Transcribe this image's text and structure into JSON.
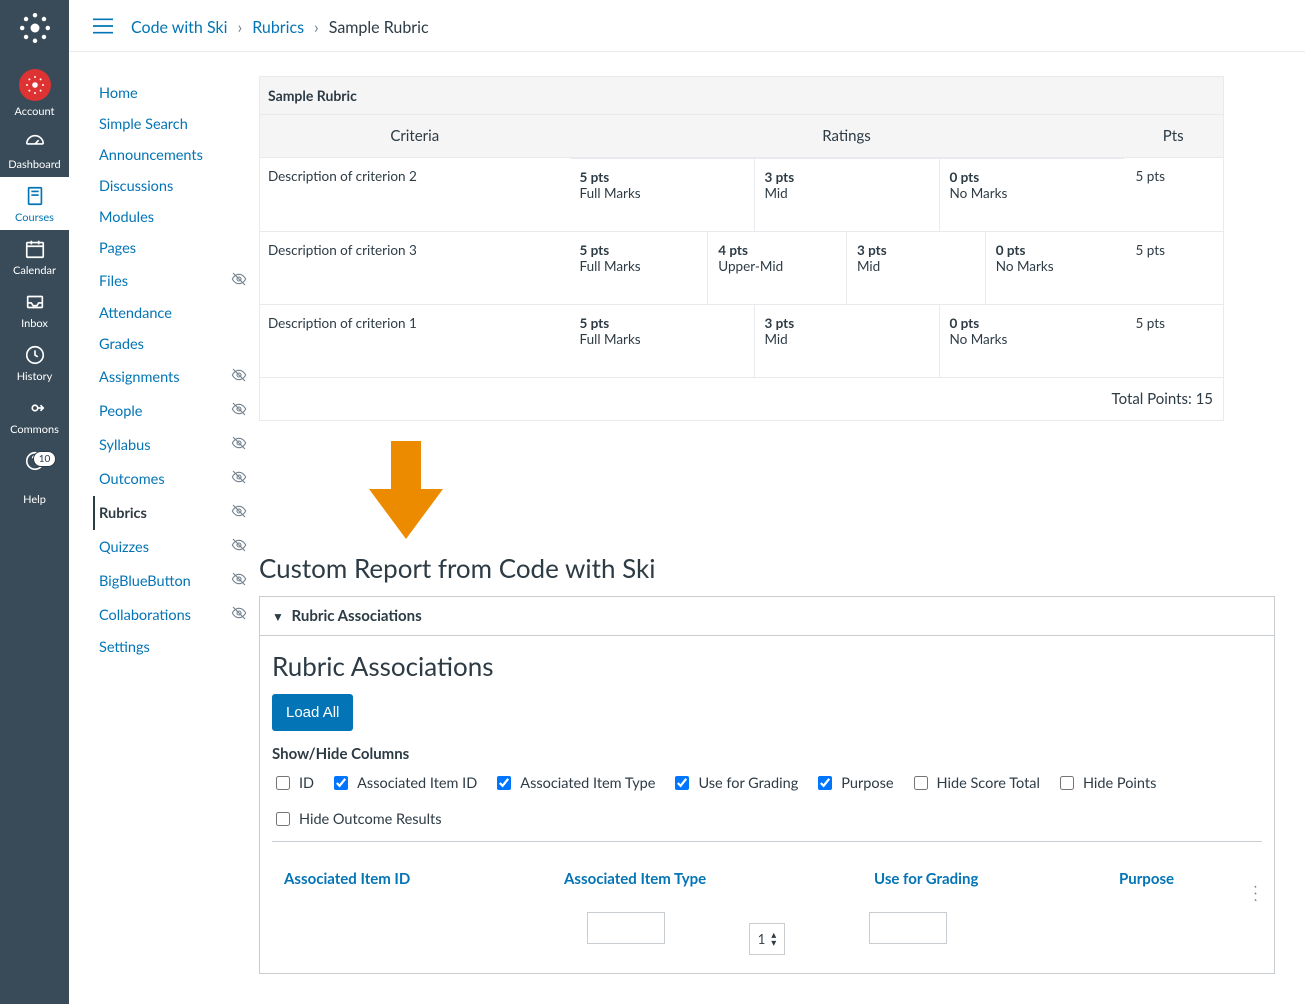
{
  "global_nav": {
    "items": [
      {
        "id": "account",
        "label": "Account"
      },
      {
        "id": "dashboard",
        "label": "Dashboard"
      },
      {
        "id": "courses",
        "label": "Courses"
      },
      {
        "id": "calendar",
        "label": "Calendar"
      },
      {
        "id": "inbox",
        "label": "Inbox"
      },
      {
        "id": "history",
        "label": "History"
      },
      {
        "id": "commons",
        "label": "Commons"
      },
      {
        "id": "help",
        "label": "Help",
        "badge": "10"
      }
    ]
  },
  "breadcrumbs": {
    "items": [
      {
        "label": "Code with Ski",
        "link": true
      },
      {
        "label": "Rubrics",
        "link": true
      },
      {
        "label": "Sample Rubric",
        "link": false
      }
    ]
  },
  "course_nav": {
    "items": [
      {
        "label": "Home"
      },
      {
        "label": "Simple Search"
      },
      {
        "label": "Announcements"
      },
      {
        "label": "Discussions"
      },
      {
        "label": "Modules"
      },
      {
        "label": "Pages"
      },
      {
        "label": "Files",
        "hidden": true
      },
      {
        "label": "Attendance"
      },
      {
        "label": "Grades"
      },
      {
        "label": "Assignments",
        "hidden": true
      },
      {
        "label": "People",
        "hidden": true
      },
      {
        "label": "Syllabus",
        "hidden": true
      },
      {
        "label": "Outcomes",
        "hidden": true
      },
      {
        "label": "Rubrics",
        "hidden": true,
        "active": true
      },
      {
        "label": "Quizzes",
        "hidden": true
      },
      {
        "label": "BigBlueButton",
        "hidden": true
      },
      {
        "label": "Collaborations",
        "hidden": true
      },
      {
        "label": "Settings"
      }
    ]
  },
  "rubric": {
    "title": "Sample Rubric",
    "headers": {
      "criteria": "Criteria",
      "ratings": "Ratings",
      "pts": "Pts"
    },
    "rows": [
      {
        "criterion": "Description of criterion 2",
        "ratings": [
          {
            "pts": "5 pts",
            "label": "Full Marks"
          },
          {
            "pts": "3 pts",
            "label": "Mid"
          },
          {
            "pts": "0 pts",
            "label": "No Marks"
          }
        ],
        "points": "5 pts"
      },
      {
        "criterion": "Description of criterion 3",
        "ratings": [
          {
            "pts": "5 pts",
            "label": "Full Marks"
          },
          {
            "pts": "4 pts",
            "label": "Upper-Mid"
          },
          {
            "pts": "3 pts",
            "label": "Mid"
          },
          {
            "pts": "0 pts",
            "label": "No Marks"
          }
        ],
        "points": "5 pts"
      },
      {
        "criterion": "Description of criterion 1",
        "ratings": [
          {
            "pts": "5 pts",
            "label": "Full Marks"
          },
          {
            "pts": "3 pts",
            "label": "Mid"
          },
          {
            "pts": "0 pts",
            "label": "No Marks"
          }
        ],
        "points": "5 pts"
      }
    ],
    "total_label": "Total Points: 15"
  },
  "report": {
    "title": "Custom Report from Code with Ski",
    "panel_title": "Rubric Associations",
    "section_title": "Rubric Associations",
    "load_btn": "Load All",
    "cols_label": "Show/Hide Columns",
    "columns": [
      {
        "label": "ID",
        "checked": false
      },
      {
        "label": "Associated Item ID",
        "checked": true
      },
      {
        "label": "Associated Item Type",
        "checked": true
      },
      {
        "label": "Use for Grading",
        "checked": true
      },
      {
        "label": "Purpose",
        "checked": true
      },
      {
        "label": "Hide Score Total",
        "checked": false
      },
      {
        "label": "Hide Points",
        "checked": false
      },
      {
        "label": "Hide Outcome Results",
        "checked": false
      }
    ],
    "table_headers": [
      "Associated Item ID",
      "Associated Item Type",
      "Use for Grading",
      "Purpose"
    ],
    "pager_value": "1"
  }
}
